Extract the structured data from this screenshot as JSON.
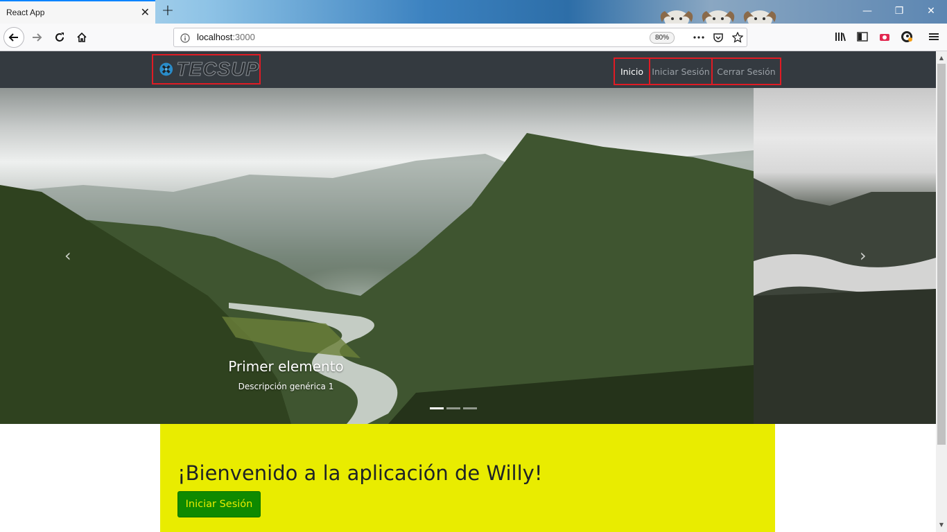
{
  "browser": {
    "tab_title": "React App",
    "tab_close": "✕",
    "new_tab": "+",
    "url_host": "localhost",
    "url_port": ":3000",
    "zoom": "80%",
    "window_controls": [
      "—",
      "❐",
      "✕"
    ]
  },
  "nav": {
    "logo_text": "TECSUP",
    "links": [
      "Inicio",
      "Iniciar Sesión",
      "Cerrar Sesión"
    ],
    "active_link": "Inicio"
  },
  "carousel": {
    "slide_title": "Primer elemento",
    "slide_description": "Descripción genérica 1",
    "prev_glyph": "‹",
    "next_glyph": "›",
    "indicator_count": 3,
    "active_indicator": 0
  },
  "jumbotron": {
    "heading": "¡Bienvenido a la aplicación de Willy!",
    "button_label": "Iniciar Sesión"
  },
  "colors": {
    "navbar": "#343a40",
    "highlight_border": "#e01b24",
    "jumbotron": "#e9ec00",
    "button": "#0f8a00"
  },
  "icons": [
    "back-icon",
    "forward-icon",
    "reload-icon",
    "home-icon",
    "info-icon",
    "more-icon",
    "pocket-icon",
    "star-icon",
    "library-icon",
    "sidebar-icon",
    "screenshot-icon",
    "extension-icon",
    "menu-icon",
    "close-icon",
    "tecsup-logo-icon"
  ]
}
